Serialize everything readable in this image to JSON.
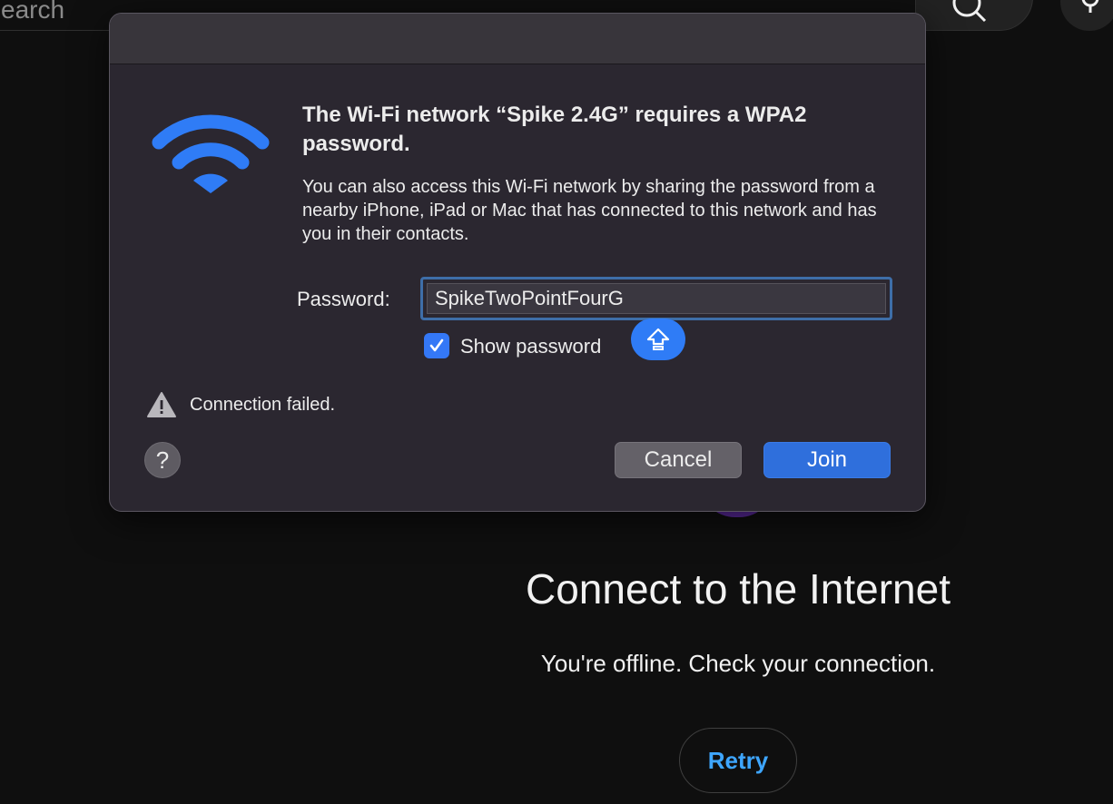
{
  "background": {
    "search": {
      "placeholder_partial": "earch"
    },
    "offline": {
      "title": "Connect to the Internet",
      "subtitle": "You're offline. Check your connection.",
      "retry_label": "Retry"
    }
  },
  "dialog": {
    "title": "The Wi-Fi network “Spike 2.4G” requires a WPA2 password.",
    "description": "You can also access this Wi-Fi network by sharing the password from a nearby iPhone, iPad or Mac that has connected to this network and has you in their contacts.",
    "password_label": "Password:",
    "password_value": "SpikeTwoPointFourG",
    "show_password_label": "Show password",
    "show_password_checked": true,
    "status_text": "Connection failed.",
    "help_label": "?",
    "cancel_label": "Cancel",
    "join_label": "Join"
  },
  "colors": {
    "wifi_icon": "#2f7cf6",
    "join_button": "#2f6fdc",
    "retry_text": "#3ea6ff",
    "dialog_bg": "#2b2730"
  },
  "icons": [
    "wifi-icon",
    "search-icon",
    "mic-icon",
    "warning-icon",
    "checkmark-icon",
    "caps-lock-icon"
  ]
}
